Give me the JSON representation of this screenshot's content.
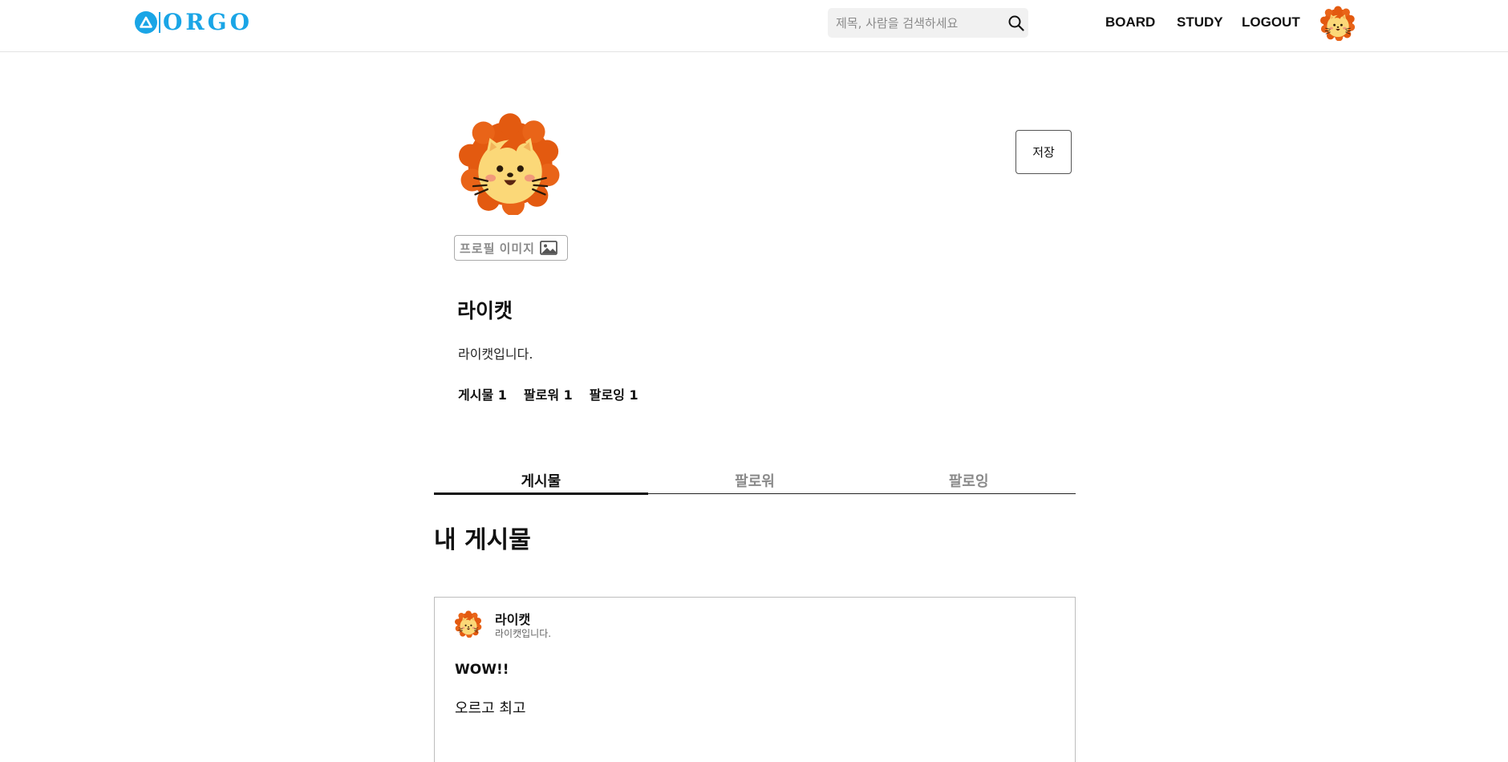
{
  "brand": {
    "name": "ORGO",
    "color": "#1aa5e6"
  },
  "header": {
    "search_placeholder": "제목, 사람을 검색하세요",
    "nav": {
      "board": "BOARD",
      "study": "STUDY",
      "logout": "LOGOUT"
    }
  },
  "profile": {
    "image_button_label": "프로필 이미지",
    "save_label": "저장",
    "nickname": "라이캣",
    "intro": "라이캣입니다.",
    "stats": {
      "posts": "게시물 1",
      "followers": "팔로워 1",
      "following": "팔로잉 1"
    }
  },
  "tabs": [
    {
      "label": "게시물",
      "active": true
    },
    {
      "label": "팔로워",
      "active": false
    },
    {
      "label": "팔로잉",
      "active": false
    }
  ],
  "section_title": "내 게시물",
  "posts": [
    {
      "author": "라이캣",
      "author_intro": "라이캣입니다.",
      "title": "WOW!!",
      "content": "오르고 최고"
    }
  ],
  "icons": {
    "logo": "triangle-logo-icon",
    "search": "search-icon",
    "image": "image-icon",
    "avatar": "lion-cat-avatar"
  }
}
